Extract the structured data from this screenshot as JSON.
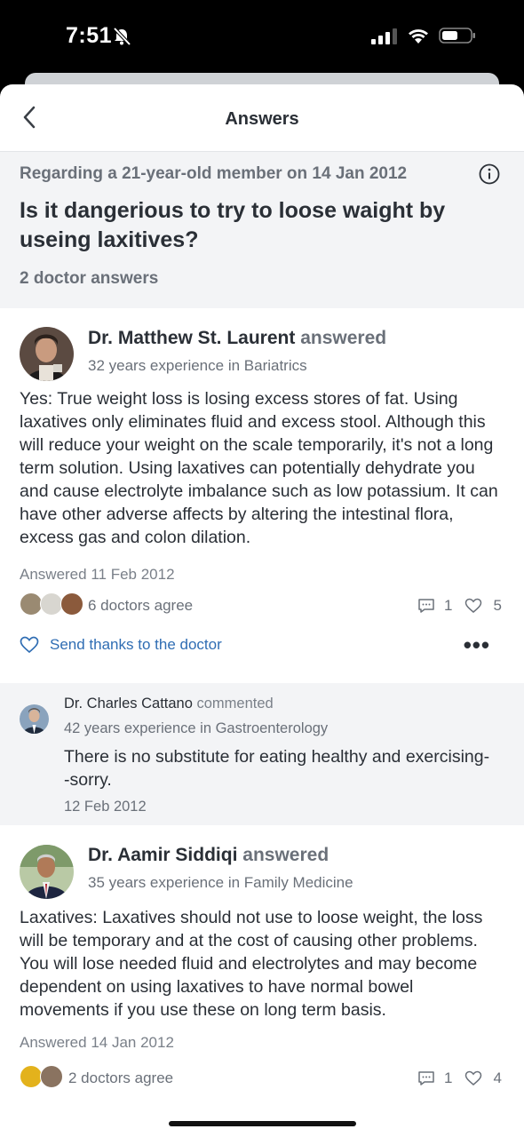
{
  "status_bar": {
    "time": "7:51"
  },
  "nav": {
    "title": "Answers"
  },
  "question": {
    "context": "Regarding a 21-year-old member on 14 Jan 2012",
    "title": "Is it dangerious to try to loose waight by useing laxitives?",
    "answer_count": "2 doctor answers"
  },
  "answers": [
    {
      "doctor": "Dr. Matthew St. Laurent",
      "verb": "answered",
      "experience": "32 years experience in Bariatrics",
      "text": "Yes: True weight loss is losing excess stores of fat. Using laxatives only eliminates fluid and excess stool. Although this will reduce your weight on the scale temporarily, it's not a long term solution. Using laxatives can potentially dehydrate you and cause electrolyte imbalance such as low potassium. It can have other adverse affects by altering the intestinal flora, excess gas and colon dilation.",
      "date": "Answered 11 Feb 2012",
      "agree": "6 doctors agree",
      "comments": "1",
      "likes": "5",
      "thanks": "Send thanks to the doctor",
      "more": "•••"
    },
    {
      "doctor": "Dr. Aamir Siddiqi",
      "verb": "answered",
      "experience": "35 years experience in Family Medicine",
      "text": "Laxatives: Laxatives should not use to loose weight, the loss will be temporary and at the cost of causing other problems. You will lose needed fluid and electrolytes and may become dependent on using laxatives to have normal bowel movements if you use these on long term basis.",
      "date": "Answered 14 Jan 2012",
      "agree": "2 doctors agree",
      "comments": "1",
      "likes": "4"
    }
  ],
  "comment": {
    "doctor": "Dr. Charles Cattano",
    "verb": "commented",
    "experience": "42 years experience in Gastroenterology",
    "text": "There is no substitute for eating healthy and exercising--sorry.",
    "date": "12 Feb 2012"
  },
  "icons": {
    "back": "chevron-left-icon",
    "info": "info-icon",
    "comment": "comment-icon",
    "like": "heart-icon",
    "thanks": "heart-outline-icon",
    "more": "more-icon"
  },
  "colors": {
    "link": "#2f6db3",
    "text": "#2a2f36",
    "muted": "#6a7079",
    "section_bg": "#f3f4f6"
  }
}
